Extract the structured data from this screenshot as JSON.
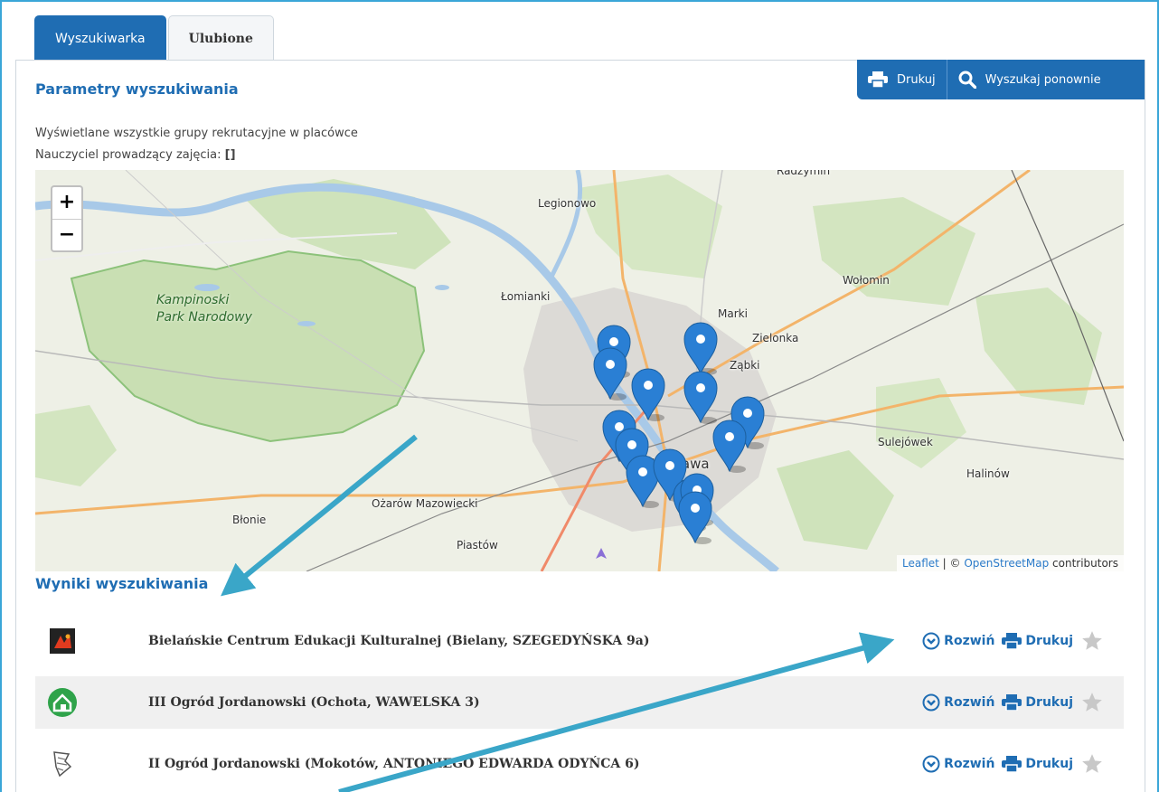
{
  "tabs": [
    {
      "label": "Wyszukiwarka",
      "active": true
    },
    {
      "label": "Ulubione",
      "active": false
    }
  ],
  "actions": {
    "print_label": "Drukuj",
    "search_again_label": "Wyszukaj ponownie"
  },
  "params": {
    "title": "Parametry wyszukiwania",
    "line1": "Wyświetlane wszystkie grupy rekrutacyjne w placówce",
    "line2_label": "Nauczyciel prowadzący zajęcia:",
    "line2_value": "[]"
  },
  "map": {
    "zoom_in": "+",
    "zoom_out": "−",
    "labels": {
      "legionowo": "Legionowo",
      "lomianki": "Łomianki",
      "marki": "Marki",
      "wolomin": "Wołomin",
      "zielonka": "Zielonka",
      "zabki": "Ząbki",
      "sulejowek": "Sulejówek",
      "halinow": "Halinów",
      "ozarow": "Ożarów Mazowiecki",
      "blonie": "Błonie",
      "piastow": "Piastów",
      "warszawa": "Warszawa",
      "radzymin": "Radzymin",
      "park_line1": "Kampinoski",
      "park_line2": "Park Narodowy"
    },
    "attribution": {
      "leaflet": "Leaflet",
      "sep": " | © ",
      "osm": "OpenStreetMap",
      "contributors": " contributors"
    },
    "marker_color": "#2a7fd4",
    "marker_count": 14
  },
  "results": {
    "title": "Wyniki wyszukiwania",
    "expand_label": "Rozwiń",
    "print_label": "Drukuj",
    "items": [
      {
        "name": "Bielańskie Centrum Edukacji Kulturalnej (Bielany, SZEGEDYŃSKA 9a)",
        "logo": "bcek-logo-icon"
      },
      {
        "name": "III Ogród Jordanowski (Ochota, WAWELSKA 3)",
        "logo": "house-circle-icon"
      },
      {
        "name": "II Ogród Jordanowski (Mokotów, ANTONIEGO EDWARDA ODYŃCA 6)",
        "logo": "sketch-logo-icon"
      }
    ]
  },
  "colors": {
    "brand": "#1f6db3",
    "annotation_arrow": "#3aa6c8"
  }
}
